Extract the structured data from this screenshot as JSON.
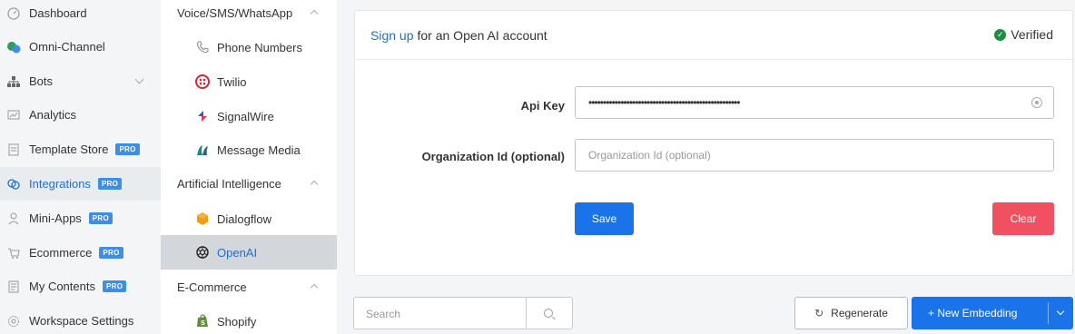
{
  "nav": {
    "items": [
      {
        "label": "Dashboard",
        "icon": "dashboard-icon"
      },
      {
        "label": "Omni-Channel",
        "icon": "chat-bubbles-icon"
      },
      {
        "label": "Bots",
        "icon": "bots-hierarchy-icon"
      },
      {
        "label": "Analytics",
        "icon": "analytics-icon"
      },
      {
        "label": "Template Store",
        "icon": "template-store-icon",
        "badge": "PRO"
      },
      {
        "label": "Integrations",
        "icon": "integrations-icon",
        "badge": "PRO",
        "active": true
      },
      {
        "label": "Mini-Apps",
        "icon": "mini-apps-icon",
        "badge": "PRO"
      },
      {
        "label": "Ecommerce",
        "icon": "cart-icon",
        "badge": "PRO"
      },
      {
        "label": "My Contents",
        "icon": "contents-icon",
        "badge": "PRO"
      },
      {
        "label": "Workspace Settings",
        "icon": "settings-gear-icon"
      }
    ]
  },
  "submenu": {
    "voice_header": "Voice/SMS/WhatsApp",
    "voice_items": [
      {
        "label": "Phone Numbers",
        "icon": "phone-icon"
      },
      {
        "label": "Twilio",
        "icon": "twilio-icon"
      },
      {
        "label": "SignalWire",
        "icon": "signalwire-icon"
      },
      {
        "label": "Message Media",
        "icon": "message-media-icon"
      }
    ],
    "ai_header": "Artificial Intelligence",
    "ai_items": [
      {
        "label": "Dialogflow",
        "icon": "dialogflow-icon"
      },
      {
        "label": "OpenAI",
        "icon": "openai-icon",
        "active": true
      }
    ],
    "ecom_header": "E-Commerce",
    "ecom_items": [
      {
        "label": "Shopify",
        "icon": "shopify-icon"
      }
    ]
  },
  "card": {
    "signup_link": "Sign up",
    "signup_rest": "for an Open AI account",
    "verified": "Verified",
    "api_key_label": "Api Key",
    "api_key_value": "••••••••••••••••••••••••••••••••••••••••••••••••••••",
    "org_label": "Organization Id (optional)",
    "org_placeholder": "Organization Id (optional)",
    "save": "Save",
    "clear": "Clear"
  },
  "bottom": {
    "search_placeholder": "Search",
    "regenerate": "Regenerate",
    "new_embedding": "+ New Embedding"
  },
  "colors": {
    "primary": "#1a73e8",
    "danger": "#f0505f",
    "verified": "#1e8e3e",
    "badge": "#3d8ee6"
  }
}
